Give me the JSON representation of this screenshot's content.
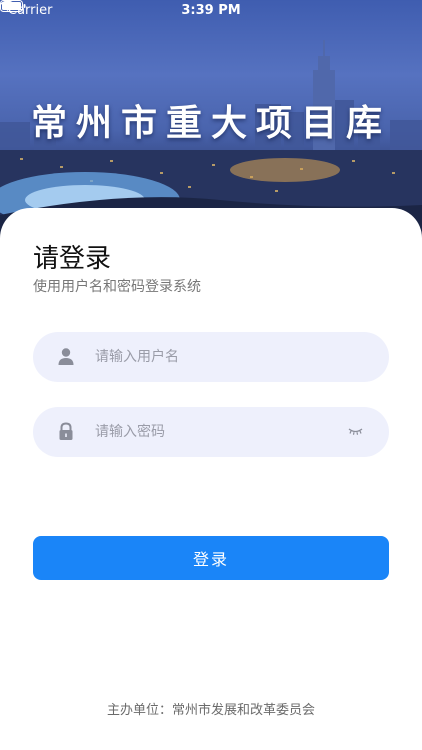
{
  "status_bar": {
    "carrier": "Carrier",
    "time": "3:39 PM",
    "wifi_icon": "wifi-icon",
    "battery_icon": "battery-icon"
  },
  "hero": {
    "title": "常州市重大项目库",
    "background": "city-skyline-night"
  },
  "login": {
    "title": "请登录",
    "subtitle": "使用用户名和密码登录系统",
    "username": {
      "placeholder": "请输入用户名",
      "value": "",
      "icon": "user-icon"
    },
    "password": {
      "placeholder": "请输入密码",
      "value": "",
      "icon": "lock-icon",
      "toggle_icon": "eye-closed-icon"
    },
    "submit_label": "登录"
  },
  "footer": {
    "text": "主办单位：常州市发展和改革委员会"
  },
  "colors": {
    "primary": "#1a85f8",
    "input_bg": "#eef0fc",
    "placeholder": "#9a9ca8"
  }
}
